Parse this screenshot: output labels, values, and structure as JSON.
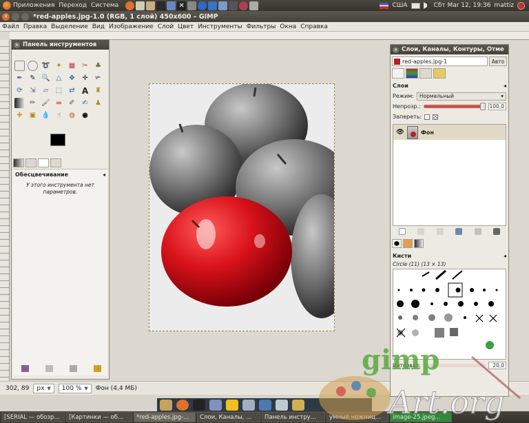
{
  "top_panel": {
    "menu": [
      "Приложения",
      "Переход",
      "Система"
    ],
    "keyboard_layout": "США",
    "clock": "Сбт Mar 12, 19:36",
    "user": "mattiz"
  },
  "image_window": {
    "title": "*red-apples.jpg-1.0 (RGB, 1 слой) 450x600 – GIMP",
    "menu": [
      "Файл",
      "Правка",
      "Выделение",
      "Вид",
      "Изображение",
      "Слой",
      "Цвет",
      "Инструменты",
      "Фильтры",
      "Окна",
      "Справка"
    ],
    "status": {
      "coords": "302, 89",
      "unit": "px",
      "zoom": "100 %",
      "info": "Фон (4,4 МБ)"
    }
  },
  "toolbox": {
    "title": "Панель инструментов",
    "options_title": "Обесцвечивание",
    "options_message": "У этого инструмента нет параметров.",
    "colors": {
      "foreground": "#000000",
      "background": "#ffffff"
    }
  },
  "layers_dock": {
    "title": "Слои, Каналы, Контуры, Отме",
    "image_select": "red-apples.jpg-1",
    "auto_button": "Авто",
    "layers": {
      "header": "Слои",
      "mode_label": "Режим:",
      "mode_value": "Нормальный",
      "opacity_label": "Непрозр.:",
      "opacity_value": "100,0",
      "lock_label": "Запереть:",
      "items": [
        {
          "name": "Фон"
        }
      ]
    },
    "brushes": {
      "header": "Кисти",
      "selected": "Circle (11) (13 × 13)",
      "spacing_label": "Интервал:",
      "spacing_value": "20,0"
    }
  },
  "taskbar": {
    "items": [
      {
        "label": "[SERIAL — обозр..."
      },
      {
        "label": "[Картинки — об..."
      },
      {
        "label": "*red-apples.jpg-..."
      },
      {
        "label": "Слои, Каналы, ..."
      },
      {
        "label": "Панель инстру..."
      },
      {
        "label": "умные ножниц..."
      },
      {
        "label": "image-25.jpeg..."
      }
    ]
  },
  "watermark": {
    "line1": "gimp",
    "line2": "Art.org"
  }
}
